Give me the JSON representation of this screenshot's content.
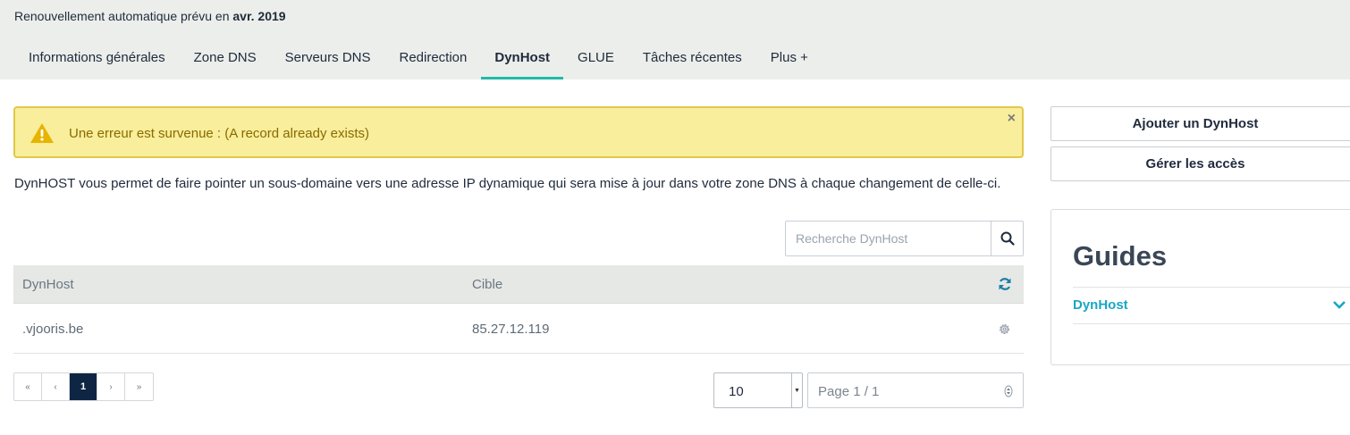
{
  "header": {
    "renewal_prefix": "Renouvellement automatique prévu en",
    "renewal_date": "avr. 2019",
    "tabs": [
      {
        "label": "Informations générales",
        "active": false
      },
      {
        "label": "Zone DNS",
        "active": false
      },
      {
        "label": "Serveurs DNS",
        "active": false
      },
      {
        "label": "Redirection",
        "active": false
      },
      {
        "label": "DynHost",
        "active": true
      },
      {
        "label": "GLUE",
        "active": false
      },
      {
        "label": "Tâches récentes",
        "active": false
      },
      {
        "label": "Plus +",
        "active": false
      }
    ]
  },
  "alert": {
    "message": "Une erreur est survenue : (A record already exists)",
    "close": "×",
    "icon": "warning-icon"
  },
  "description": "DynHOST vous permet de faire pointer un sous-domaine vers une adresse IP dynamique qui sera mise à jour dans votre zone DNS à chaque changement de celle-ci.",
  "search": {
    "placeholder": "Recherche DynHost",
    "value": "",
    "icon": "search-icon"
  },
  "table": {
    "columns": [
      "DynHost",
      "Cible"
    ],
    "rows": [
      {
        "dynhost": ".vjooris.be",
        "target": "85.27.12.119"
      }
    ]
  },
  "pagination": {
    "first": "«",
    "prev": "‹",
    "current": "1",
    "next": "›",
    "last": "»",
    "per_page": "10",
    "page_label": "Page 1 / 1"
  },
  "sidebar": {
    "add_button": "Ajouter un DynHost",
    "access_button": "Gérer les accès",
    "guides_title": "Guides",
    "guide_items": [
      {
        "label": "DynHost"
      }
    ]
  },
  "colors": {
    "accent": "#23b9a8",
    "link": "#1aa6c4",
    "alert_bg": "#f8ee9c",
    "active_page": "#0f2544"
  }
}
